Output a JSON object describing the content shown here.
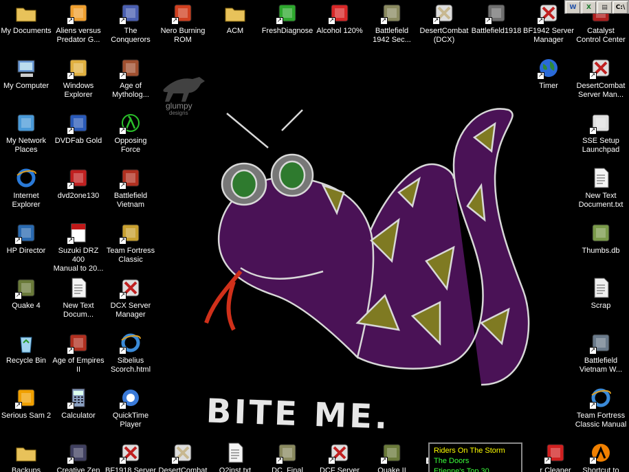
{
  "desktop": {
    "watermark": {
      "line1": "glumpy",
      "line2": "designs"
    },
    "wallpaper_caption": "BITE ME.",
    "icons": [
      {
        "label": "My Documents",
        "icon": "folder-doc-icon"
      },
      {
        "label": "Aliens versus\nPredator G...",
        "icon": "avp-icon"
      },
      {
        "label": "The\nConquerors",
        "icon": "conquerors-icon"
      },
      {
        "label": "Nero Burning\nROM",
        "icon": "nero-icon"
      },
      {
        "label": "ACM",
        "icon": "folder-icon"
      },
      {
        "label": "FreshDiagnose",
        "icon": "freshdiagnose-icon"
      },
      {
        "label": "Alcohol 120%",
        "icon": "alcohol-icon"
      },
      {
        "label": "Battlefield\n1942 Sec...",
        "icon": "battlefield-icon"
      },
      {
        "label": "DesertCombat\n(DCX)",
        "icon": "desertcombat-icon"
      },
      {
        "label": "Battlefield1918",
        "icon": "bf1918-icon"
      },
      {
        "label": "BF1942 Server\nManager",
        "icon": "server-manager-icon"
      },
      {
        "label": "Catalyst\nControl Center",
        "icon": "catalyst-icon"
      },
      {
        "label": "My Computer",
        "icon": "computer-icon"
      },
      {
        "label": "Windows\nExplorer",
        "icon": "explorer-icon"
      },
      {
        "label": "Age of\nMytholog...",
        "icon": "mythology-icon"
      },
      {
        "label": "Timer",
        "icon": "globe-icon"
      },
      {
        "label": "DesertCombat\nServer Man...",
        "icon": "server-manager-icon"
      },
      {
        "label": "My Network\nPlaces",
        "icon": "network-icon"
      },
      {
        "label": "DVDFab Gold",
        "icon": "dvdfab-icon"
      },
      {
        "label": "Opposing\nForce",
        "icon": "lambda-icon"
      },
      {
        "label": "SSE Setup\nLaunchpad",
        "icon": "shuttle-icon"
      },
      {
        "label": "Internet\nExplorer",
        "icon": "ie-icon"
      },
      {
        "label": "dvd2one130",
        "icon": "dvd2one-icon"
      },
      {
        "label": "Battlefield\nVietnam",
        "icon": "bfv-icon"
      },
      {
        "label": "New Text\nDocument.txt",
        "icon": "text-doc-icon"
      },
      {
        "label": "HP Director",
        "icon": "hp-icon"
      },
      {
        "label": "Suzuki DRZ 400\nManual to 20...",
        "icon": "pdf-icon"
      },
      {
        "label": "Team Fortress\nClassic",
        "icon": "tfc-icon"
      },
      {
        "label": "Thumbs.db",
        "icon": "thumbs-icon"
      },
      {
        "label": "Quake 4",
        "icon": "quake-icon"
      },
      {
        "label": "New Text\nDocum...",
        "icon": "text-doc-icon"
      },
      {
        "label": "DCX Server\nManager",
        "icon": "server-manager-icon"
      },
      {
        "label": "Scrap",
        "icon": "scrap-icon"
      },
      {
        "label": "Recycle Bin",
        "icon": "recycle-icon"
      },
      {
        "label": "Age of Empires\nII",
        "icon": "aoe-icon"
      },
      {
        "label": "Sibelius\nScorch.html",
        "icon": "ie-doc-icon"
      },
      {
        "label": "Battlefield\nVietnam W...",
        "icon": "bfv-ship-icon"
      },
      {
        "label": "Serious Sam 2",
        "icon": "serious-sam-icon"
      },
      {
        "label": "Calculator",
        "icon": "calculator-icon"
      },
      {
        "label": "QuickTime\nPlayer",
        "icon": "quicktime-icon"
      },
      {
        "label": "Team Fortress\nClassic Manual",
        "icon": "ie-doc-icon"
      },
      {
        "label": "Backups",
        "icon": "folder-icon"
      },
      {
        "label": "Creative Zen",
        "icon": "zen-icon"
      },
      {
        "label": "BF1918 Server",
        "icon": "server-manager-icon"
      },
      {
        "label": "DesertCombat",
        "icon": "desertcombat-icon"
      },
      {
        "label": "Q2inst.txt",
        "icon": "text-doc-icon"
      },
      {
        "label": "DC_Final",
        "icon": "battlefield-icon"
      },
      {
        "label": "DCF Server",
        "icon": "server-manager-icon"
      },
      {
        "label": "Quake II",
        "icon": "quake-icon"
      },
      {
        "label": "Sh",
        "icon": "sh-icon"
      },
      {
        "label": "r Cleaner",
        "icon": "cleaner-icon"
      },
      {
        "label": "Shortcut to",
        "icon": "halflife-icon"
      }
    ]
  },
  "tray": {
    "buttons": [
      {
        "label": "W",
        "icon": "word-icon",
        "color": "#1f4fa8"
      },
      {
        "label": "X",
        "icon": "excel-icon",
        "color": "#1c7a2e"
      },
      {
        "label": "▤",
        "icon": "doc-icon",
        "color": "#333333"
      },
      {
        "label": "C:\\",
        "icon": "console-icon",
        "color": "#000000"
      }
    ]
  },
  "winamp": {
    "lines": [
      "Riders On The Storm",
      "The Doors",
      "Etienne's Top 30"
    ]
  },
  "colors": {
    "background": "#000000",
    "label": "#ffffff",
    "snake": "#5a1466",
    "scales": "#8c8a28",
    "winamp_text": "#3cff3c"
  }
}
